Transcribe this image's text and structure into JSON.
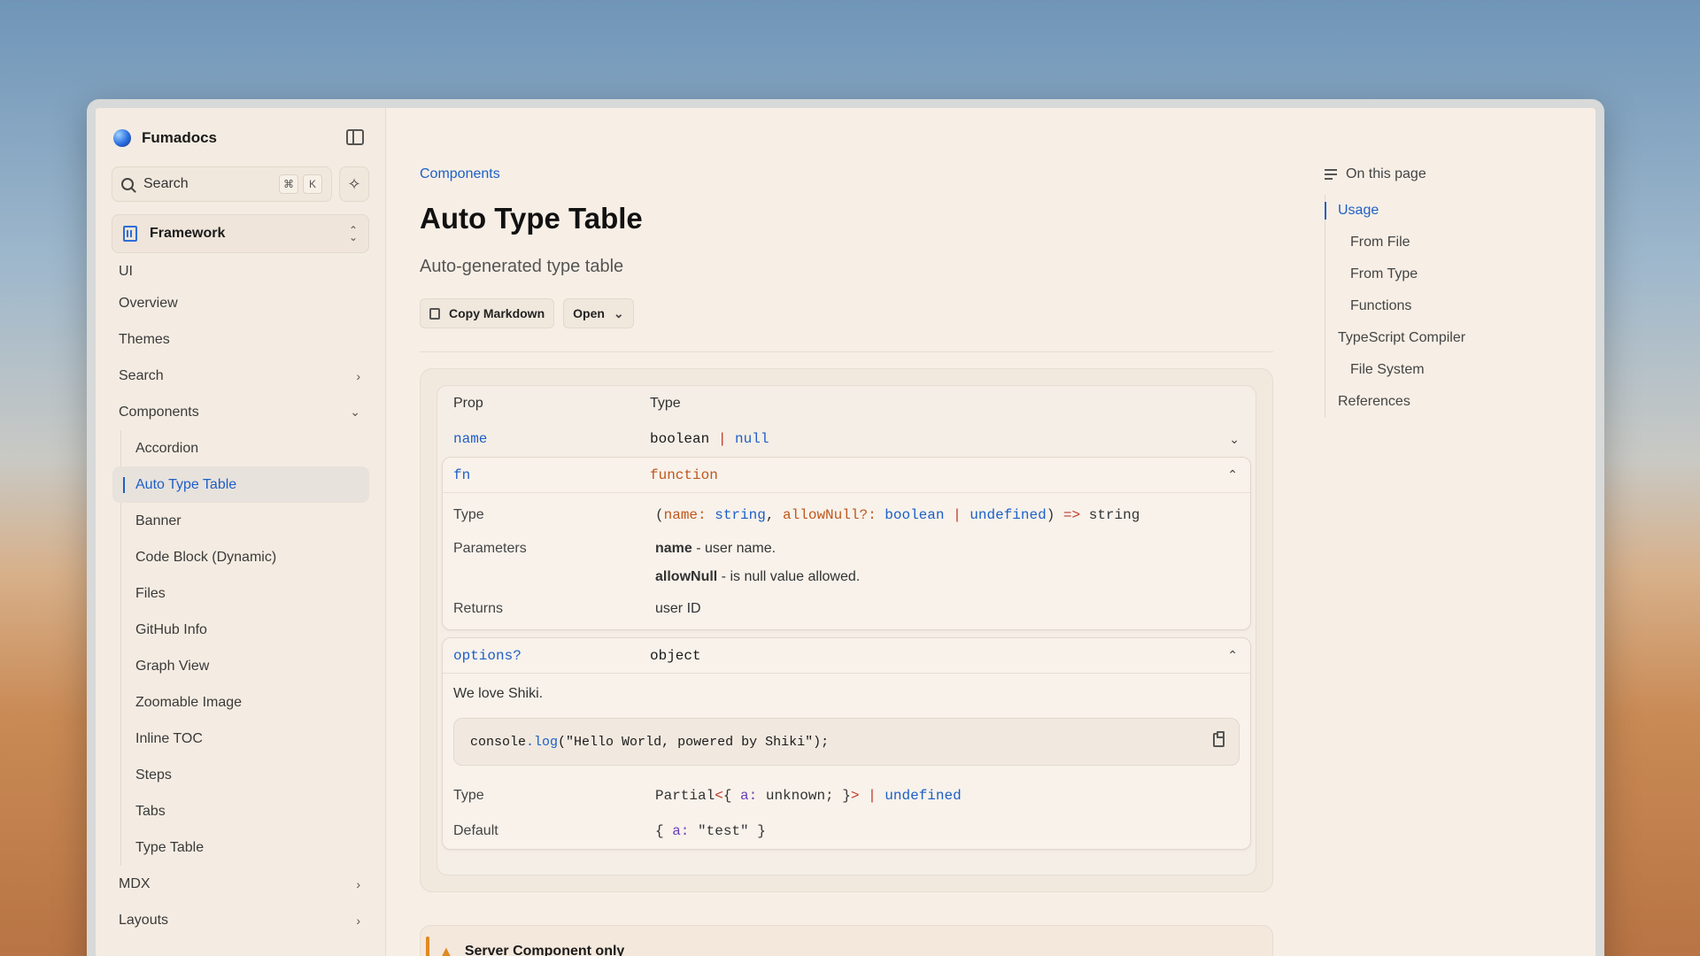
{
  "brand": {
    "name": "Fumadocs"
  },
  "search": {
    "label": "Search",
    "kbd1": "⌘",
    "kbd2": "K"
  },
  "framework": {
    "label": "Framework"
  },
  "nav": {
    "section": "UI",
    "items": [
      {
        "label": "Overview"
      },
      {
        "label": "Themes"
      },
      {
        "label": "Search",
        "chevron": "›"
      },
      {
        "label": "Components",
        "chevron": "⌄"
      }
    ],
    "components": [
      "Accordion",
      "Auto Type Table",
      "Banner",
      "Code Block (Dynamic)",
      "Files",
      "GitHub Info",
      "Graph View",
      "Zoomable Image",
      "Inline TOC",
      "Steps",
      "Tabs",
      "Type Table"
    ],
    "after": [
      {
        "label": "MDX",
        "chevron": "›"
      },
      {
        "label": "Layouts",
        "chevron": "›"
      }
    ]
  },
  "page": {
    "breadcrumb": "Components",
    "title": "Auto Type Table",
    "subtitle": "Auto-generated type table",
    "copy_markdown": "Copy Markdown",
    "open": "Open"
  },
  "table": {
    "header_prop": "Prop",
    "header_type": "Type",
    "row_name": {
      "prop": "name",
      "type_a": "boolean",
      "sep": " | ",
      "type_b": "null"
    },
    "row_fn": {
      "prop": "fn",
      "type": "function",
      "type_label": "Type",
      "sig": {
        "open": "(",
        "p1": "name:",
        "t1": " string",
        "comma": ", ",
        "p2": "allowNull?:",
        "t2": " boolean",
        "sep": " | ",
        "t3": "undefined",
        "close": ") ",
        "arrow": "=>",
        "ret": " string"
      },
      "params_label": "Parameters",
      "param1_name": "name",
      "param1_desc": " - user name.",
      "param2_name": "allowNull",
      "param2_desc": " - is null value allowed.",
      "returns_label": "Returns",
      "returns": "user ID"
    },
    "row_options": {
      "prop": "options?",
      "type": "object",
      "desc": "We love Shiki.",
      "code": {
        "obj": "console",
        "dot": ".",
        "fn": "log",
        "arg": "(\"Hello World, powered by Shiki\");"
      },
      "type_label": "Type",
      "type_value": {
        "a": "Partial",
        "b": "<",
        "c": "{ ",
        "d": "a:",
        "e": " unknown; }",
        "f": ">",
        "g": " | ",
        "h": "undefined"
      },
      "default_label": "Default",
      "default_value": {
        "a": "{ ",
        "b": "a:",
        "c": " \"test\" }"
      }
    }
  },
  "callout": {
    "text": "Server Component only"
  },
  "toc": {
    "heading": "On this page",
    "items": [
      {
        "label": "Usage",
        "level": 1
      },
      {
        "label": "From File",
        "level": 2
      },
      {
        "label": "From Type",
        "level": 2
      },
      {
        "label": "Functions",
        "level": 2
      },
      {
        "label": "TypeScript Compiler",
        "level": 1
      },
      {
        "label": "File System",
        "level": 2
      },
      {
        "label": "References",
        "level": 1
      }
    ]
  },
  "colors": {
    "accent": "#1d5fc7",
    "warning": "#e08a22",
    "background": "#f7efe6"
  }
}
